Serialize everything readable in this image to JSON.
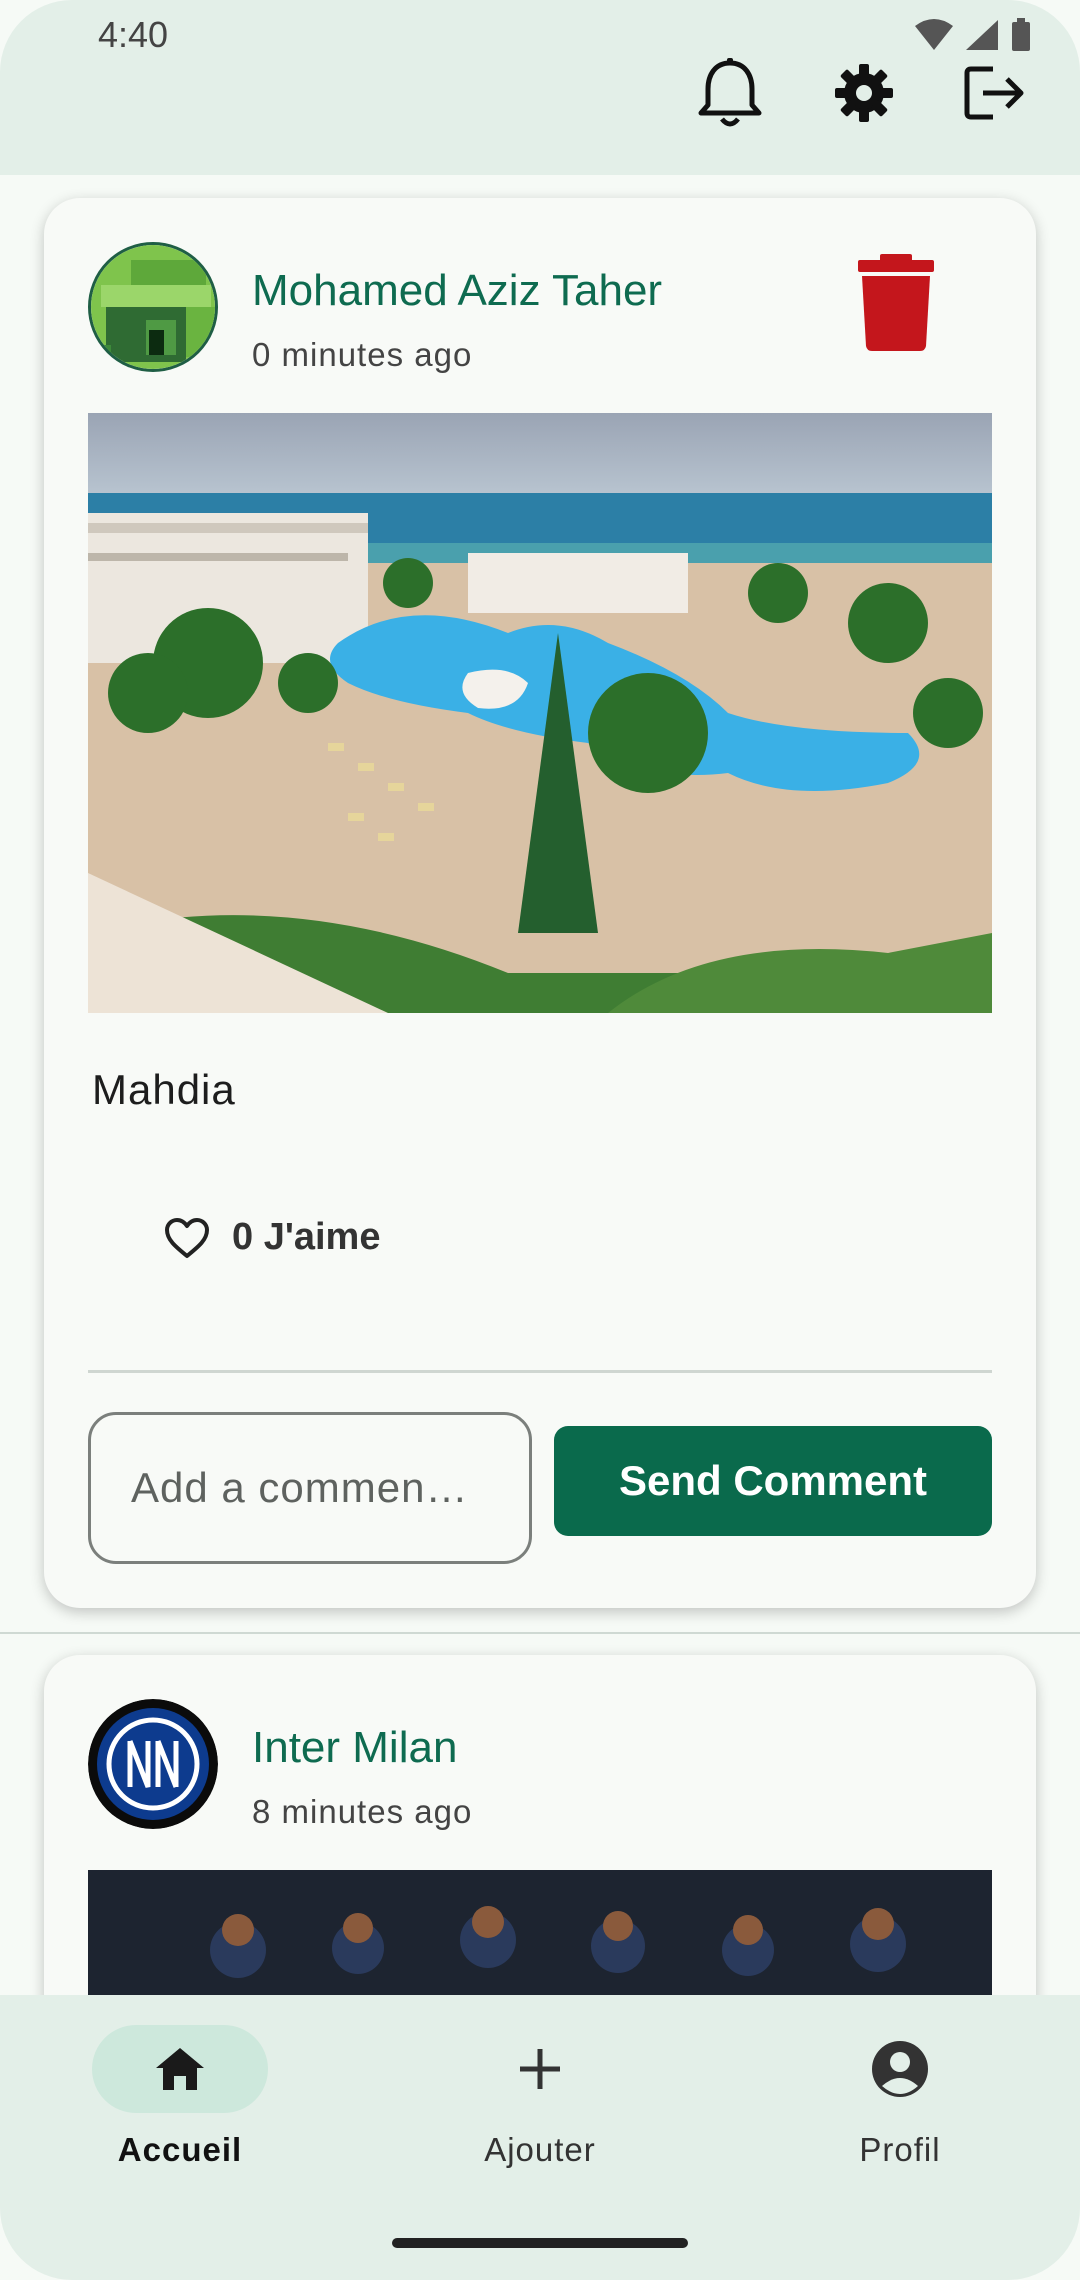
{
  "status_bar": {
    "time": "4:40"
  },
  "header": {
    "icons": [
      "bell-icon",
      "settings-gear-icon",
      "logout-icon"
    ]
  },
  "posts": [
    {
      "author": "Mohamed Aziz Taher",
      "time": "0 minutes ago",
      "caption": "Mahdia",
      "likes_label": "0 J'aime",
      "comment_placeholder": "Add a commen…",
      "send_label": "Send Comment"
    },
    {
      "author": "Inter Milan",
      "time": "8 minutes ago"
    }
  ],
  "bottom_nav": [
    {
      "label": "Accueil",
      "icon": "home-icon",
      "active": true
    },
    {
      "label": "Ajouter",
      "icon": "plus-icon",
      "active": false
    },
    {
      "label": "Profil",
      "icon": "account-circle-icon",
      "active": false
    }
  ],
  "colors": {
    "accent": "#0a6a4c",
    "author_text": "#0e6b50",
    "delete": "#c4161c",
    "bar_background": "#e3efe8",
    "nav_active_pill": "#cde8dc"
  }
}
